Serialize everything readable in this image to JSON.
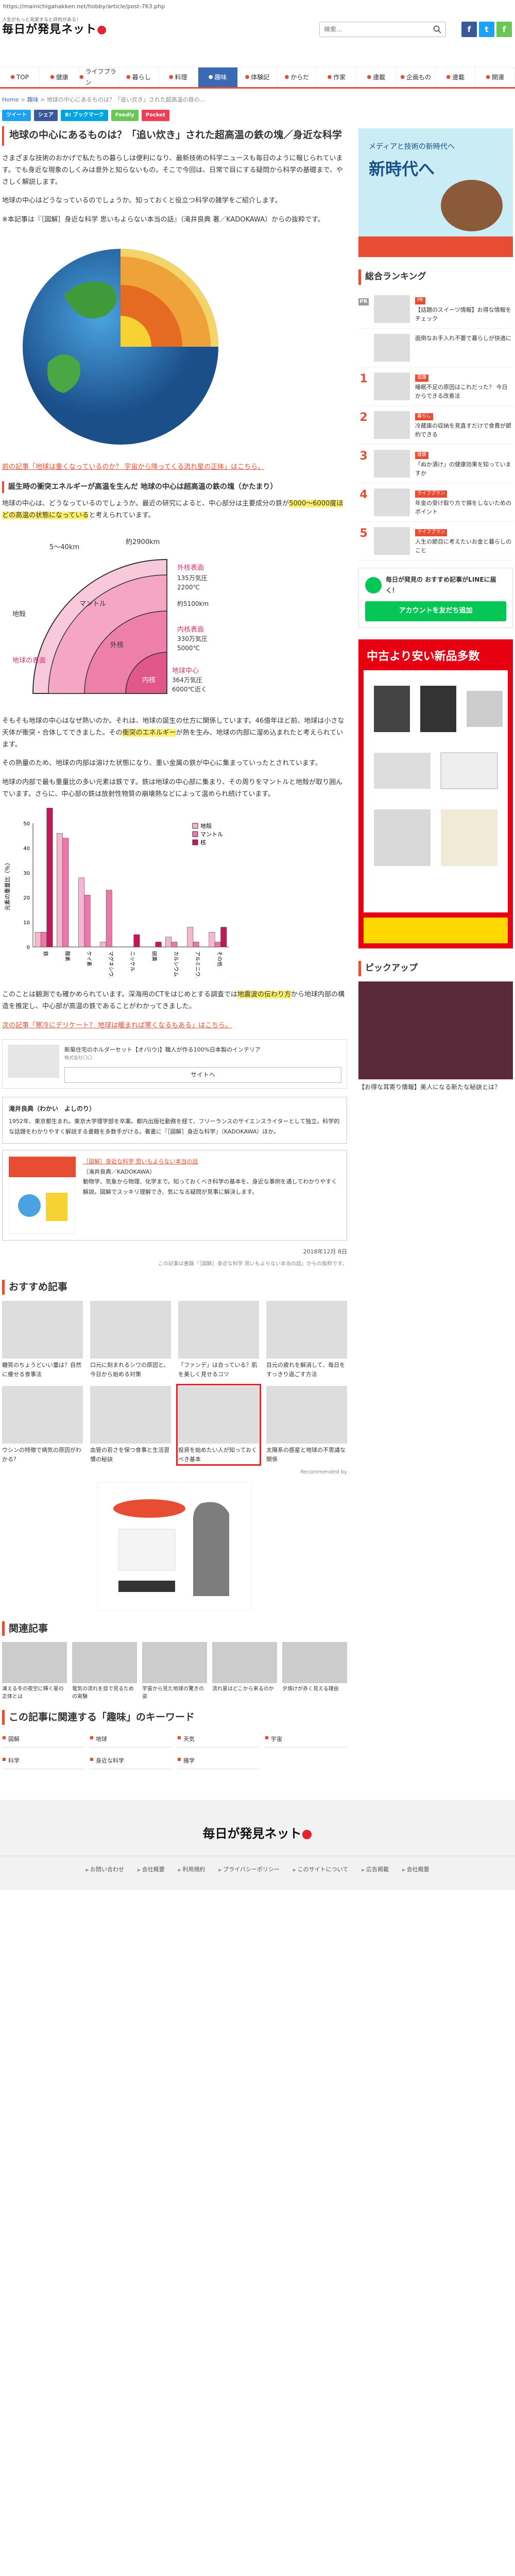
{
  "browser": {
    "url": "https://mainichigahakken.net/hobby/article/post-763.php"
  },
  "header": {
    "tagline": "人生がもっと充実すると評判がある！",
    "logo_text": "毎日が発見ネット",
    "search_placeholder": "検索..."
  },
  "nav": {
    "items": [
      {
        "label": "TOP",
        "active": false
      },
      {
        "label": "健康",
        "active": false
      },
      {
        "label": "ライフプラン",
        "active": false
      },
      {
        "label": "暮らし",
        "active": false
      },
      {
        "label": "料理",
        "active": false
      },
      {
        "label": "趣味",
        "active": true
      },
      {
        "label": "体験記",
        "active": false
      },
      {
        "label": "からだ",
        "active": false
      },
      {
        "label": "作家",
        "active": false
      },
      {
        "label": "連載",
        "active": false
      },
      {
        "label": "企画もの",
        "active": false
      },
      {
        "label": "連載",
        "active": false
      },
      {
        "label": "開運",
        "active": false
      }
    ]
  },
  "breadcrumb": {
    "home": "Home",
    "趣味": "趣味",
    "current": "地球の中心にあるものは？「追い炊き」された超高温の鉄の..."
  },
  "share": [
    "ツイート",
    "シェア",
    "B! ブックマーク",
    "Feedly",
    "Pocket"
  ],
  "article": {
    "title": "地球の中心にあるものは？「追い炊き」された超高温の鉄の塊／身近な科学",
    "p1": "さまざまな技術のおかげで私たちの暮らしは便利になり、最新技術の科学ニュースも毎日のように報じられています。でも身近な現象のしくみは意外と知らないもの。そこで今回は、日常で目にする疑問から科学の基礎まで、やさしく解説します。",
    "p2": "地球の中心はどうなっているのでしょうか。知っておくと役立つ科学の雑学をご紹介します。",
    "p3": "※本記事は『［図解］身近な科学 思いもよらない本当の話』（滝井良典 著／KADOKAWA）からの抜粋です。",
    "link1": "前の記事「地球は重くなっているのか？ 宇宙から降ってくる流れ星の正体」はこちら。",
    "h2": "誕生時の衝突エネルギーが高温を生んだ 地球の中心は超高温の鉄の塊（かたまり）",
    "p4_a": "地球の中心は、どうなっているのでしょうか。最近の研究によると、中心部分は主要成分の鉄が",
    "p4_hl": "5000〜6000度ほどの高温の状態になっている",
    "p4_b": "と考えられています。",
    "p5_a": "そもそも地球の中心はなぜ熱いのか。それは、地球の誕生の仕方に関係しています。46億年ほど前、地球は小さな天体が衝突・合体してできました。その",
    "p5_hl": "衝突のエネルギー",
    "p5_b": "が熱を生み、地球の内部に溜め込まれたと考えられています。",
    "p6": "その熱量のため、地球の内部は溶けた状態になり、重い金属の鉄が中心に集まっていったとされています。",
    "p7": "地球の内部で最も重量比の多い元素は鉄です。鉄は地球の中心部に集まり、その周りをマントルと地殻が取り囲んでいます。さらに、中心部の鉄は放射性物質の崩壊熱などによって温められ続けています。",
    "p8_a": "このことは観測でも確かめられています。深海用のCTをはじめとする調査では",
    "p8_hl": "地震波の伝わり方",
    "p8_b": "から地球内部の構造を推定し、中心部が高温の鉄であることがわかってきました。",
    "link2": "次の記事「寒冷にデリケート？ 地球は暖まれば寒くなるもある」はこちら。"
  },
  "figure1": {
    "labels": {
      "crust_depth": "5〜40km",
      "mantle_depth": "約2900km",
      "outer_core": "外核表面",
      "outer_pressure": "135万気圧",
      "outer_temp": "2200℃",
      "core_depth": "約5100km",
      "crust": "地殻",
      "mantle": "マントル",
      "outer": "外核",
      "inner": "内核",
      "surface": "地球の表面",
      "inner_surface": "内核表面",
      "inner_pressure": "330万気圧",
      "inner_temp": "5000℃",
      "center": "地球中心",
      "center_pressure": "364万気圧",
      "center_temp": "6000℃近く"
    }
  },
  "chart_data": {
    "type": "bar",
    "title": "",
    "ylabel": "元素の重量比（％）",
    "ylim": [
      0,
      50
    ],
    "legend": [
      "地殻",
      "マントル",
      "核"
    ],
    "categories": [
      "鉄",
      "酸素",
      "ケイ素",
      "マグネシウム",
      "ニッケル",
      "硫黄",
      "カルシウム",
      "アルミニウム",
      "その他"
    ],
    "series": [
      {
        "name": "地殻",
        "values": [
          6,
          46,
          28,
          2,
          0,
          0,
          4,
          8,
          6
        ]
      },
      {
        "name": "マントル",
        "values": [
          6,
          44,
          21,
          23,
          0,
          0,
          2,
          2,
          2
        ]
      },
      {
        "name": "核",
        "values": [
          85,
          0,
          0,
          0,
          5,
          2,
          0,
          0,
          8
        ]
      }
    ]
  },
  "ad_inline": {
    "title": "新築住宅のホルダーセット【オパ(ウ)】職人が作る100%日本製のインテリア",
    "source": "株式会社〇〇",
    "button": "サイトへ"
  },
  "author": {
    "name": "滝井良典（わかい　よしのり）",
    "bio": "1952年、東京都生まれ。東京大学理学部を卒業。都内出版社勤務を経て、フリーランスのサイエンスライターとして独立。科学的な話題をわかりやすく解説する書籍を多数手がける。著書に『［図解］身近な科学』（KADOKAWA）ほか。"
  },
  "book": {
    "title": "［図解］身近な科学 思いもよらない本当の話",
    "author": "（滝井良典／KADOKAWA）",
    "desc": "動物学、気象から物理、化学まで。知っておくべき科学の基本を、身近な事例を通してわかりやすく解説。図解でスッキリ理解でき、気になる疑問が見事に解決します。"
  },
  "pubdate": "2018年12月 8日",
  "note": "この記事は書籍『［図解］身近な科学 思いもよらない本当の話』からの抜粋です。",
  "recommend": {
    "heading": "おすすめ記事",
    "items": [
      "糖質のちょうどいい量は？自然に痩せる食事法",
      "口元に刻まれるシワの原因と、今日から始める対策",
      "「ファンデ」は合っている？肌を美しく見せるコツ",
      "目元の疲れを解消して、毎日をすっきり過ごす方法",
      "ウシンの特徴で病気の原因がわかる？",
      "血管の若さを保つ食事と生活習慣の秘訣",
      "投資を始めたい人が知っておくべき基本",
      "太陽系の惑星と地球の不思議な関係"
    ],
    "highlighted_index": 6,
    "by": "Recommended by"
  },
  "related": {
    "heading": "関連記事",
    "items": [
      "凍える冬の夜空に輝く星の正体とは",
      "電気の流れを目で見るための実験",
      "宇宙から見た地球の驚きの姿",
      "流れ星はどこから来るのか",
      "夕焼けが赤く見える理由"
    ]
  },
  "keywords": {
    "heading": "この記事に関連する「趣味」のキーワード",
    "items": [
      "図解",
      "地球",
      "天気",
      "宇宙",
      "科学",
      "身近な科学",
      "雑学",
      ""
    ]
  },
  "sidebar": {
    "ad1_line1": "メディアと技術の新時代へ",
    "ad1_line2": "新時代へ",
    "ranking_title": "総合ランキング",
    "ranking": [
      {
        "no": "PR",
        "cat": "PR",
        "text": "【話題のスイーツ情報】お得な情報をチェック"
      },
      {
        "no": "",
        "cat": "",
        "text": "面倒なお手入れ不要で暮らしが快適に"
      },
      {
        "no": "1",
        "cat": "健康",
        "text": "睡眠不足の原因はこれだった？ 今日からできる改善法"
      },
      {
        "no": "2",
        "cat": "暮らし",
        "text": "冷蔵庫の収納を見直すだけで食費が節約できる"
      },
      {
        "no": "3",
        "cat": "健康",
        "text": "「ぬか漬け」の健康効果を知っていますか"
      },
      {
        "no": "4",
        "cat": "ライフプラン",
        "text": "年金の受け取り方で損をしないためのポイント"
      },
      {
        "no": "5",
        "cat": "ライフプラン",
        "text": "人生の節目に考えたいお金と暮らしのこと"
      }
    ],
    "line_title": "毎日が発見の おすすめ記事がLINEに届く！",
    "line_button": "アカウントを友だち追加",
    "ad2_line1": "中古より安い新品多数",
    "pickup_title": "ピックアップ",
    "pickup_caption": "【お得な耳寄り情報】美人になる新たな秘訣とは？"
  },
  "footer": {
    "logo": "毎日が発見ネット",
    "links": [
      "お問い合わせ",
      "会社概要",
      "利用規約",
      "プライバシーポリシー",
      "このサイトについて",
      "広告掲載",
      "会社概要"
    ]
  },
  "colors": {
    "accent": "#e64d32",
    "nav_active": "#3b6ab5",
    "highlight": "#fff06b"
  }
}
